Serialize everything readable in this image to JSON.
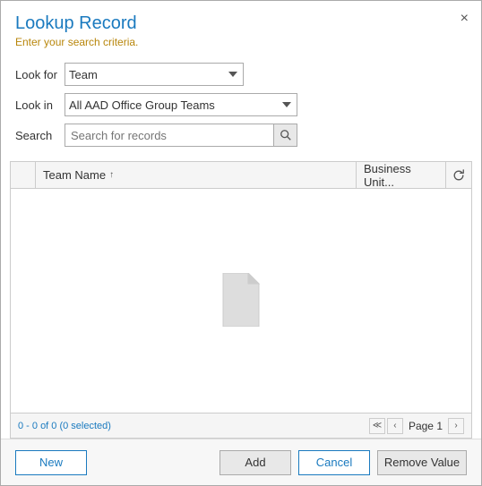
{
  "dialog": {
    "title": "Lookup Record",
    "subtitle": "Enter your search criteria.",
    "close_label": "×"
  },
  "form": {
    "look_for_label": "Look for",
    "look_in_label": "Look in",
    "search_label": "Search",
    "look_for_value": "Team",
    "look_for_options": [
      "Team"
    ],
    "look_in_value": "All AAD Office Group Teams",
    "look_in_options": [
      "All AAD Office Group Teams"
    ],
    "search_placeholder": "Search for records"
  },
  "table": {
    "col_teamname": "Team Name",
    "col_businessunit": "Business Unit...",
    "sort_arrow": "↑",
    "empty_state": true
  },
  "footer": {
    "record_count": "0 - 0 of 0 (0 selected)",
    "page_label": "Page 1"
  },
  "buttons": {
    "new_label": "New",
    "add_label": "Add",
    "cancel_label": "Cancel",
    "remove_value_label": "Remove Value"
  }
}
